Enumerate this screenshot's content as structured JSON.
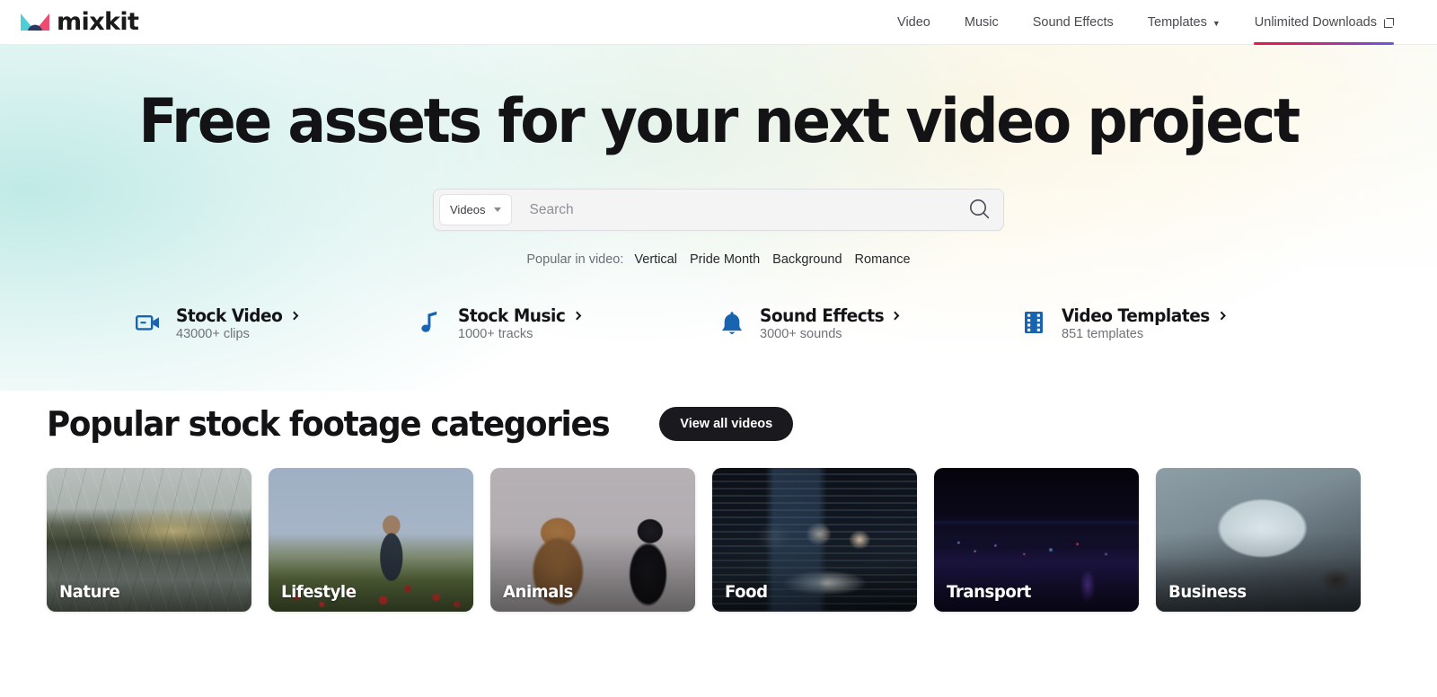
{
  "header": {
    "logo_text": "mixkit",
    "logo_icon": "mixkit-m-logo-icon",
    "nav": [
      {
        "label": "Video",
        "icon": null,
        "active": false
      },
      {
        "label": "Music",
        "icon": null,
        "active": false
      },
      {
        "label": "Sound Effects",
        "icon": null,
        "active": false
      },
      {
        "label": "Templates",
        "icon": "chevron-down-icon",
        "active": false
      },
      {
        "label": "Unlimited Downloads",
        "icon": "external-link-icon",
        "active": true
      }
    ],
    "active_underline_gradient": [
      "#e8174a",
      "#7b4ddb"
    ]
  },
  "hero": {
    "title": "Free assets for your next video project",
    "search": {
      "type_selected": "Videos",
      "type_caret_icon": "caret-down-icon",
      "value": "",
      "placeholder": "Search",
      "submit_icon": "search-icon"
    },
    "popular": {
      "label": "Popular in video:",
      "tags": [
        "Vertical",
        "Pride Month",
        "Background",
        "Romance"
      ]
    },
    "shortcuts": [
      {
        "icon": "video-camera-icon",
        "title": "Stock Video",
        "chevron": "chevron-right-icon",
        "subtitle": "43000+ clips"
      },
      {
        "icon": "music-note-icon",
        "title": "Stock Music",
        "chevron": "chevron-right-icon",
        "subtitle": "1000+ tracks"
      },
      {
        "icon": "bell-icon",
        "title": "Sound Effects",
        "chevron": "chevron-right-icon",
        "subtitle": "3000+ sounds"
      },
      {
        "icon": "film-strip-icon",
        "title": "Video Templates",
        "chevron": "chevron-right-icon",
        "subtitle": "851 templates"
      }
    ],
    "icon_color": "#1964b0"
  },
  "categories_section": {
    "title": "Popular stock footage categories",
    "view_all_label": "View all videos",
    "cards": [
      {
        "label": "Nature",
        "art": "img-nature"
      },
      {
        "label": "Lifestyle",
        "art": "img-lifestyle"
      },
      {
        "label": "Animals",
        "art": "img-animals"
      },
      {
        "label": "Food",
        "art": "img-food"
      },
      {
        "label": "Transport",
        "art": "img-transport"
      },
      {
        "label": "Business",
        "art": "img-business"
      }
    ]
  }
}
